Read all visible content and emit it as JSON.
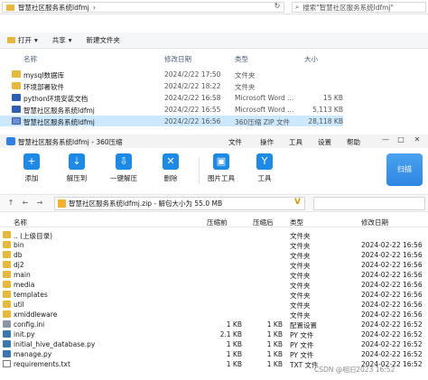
{
  "explorer": {
    "path": [
      "智慧社区服务系统ldfmj",
      "›"
    ],
    "search_placeholder": "搜索\"智慧社区服务系统ldfmj\"",
    "toolbar": {
      "open": "打开",
      "share": "共享",
      "new_folder": "新建文件夹"
    },
    "columns": {
      "name": "名称",
      "date": "修改日期",
      "type": "类型",
      "size": "大小"
    },
    "rows": [
      {
        "name": "mysql数据库",
        "date": "2024/2/22 17:50",
        "type": "文件夹",
        "size": "",
        "icon": "folder"
      },
      {
        "name": "环境部署软件",
        "date": "2024/2/22 18:22",
        "type": "文件夹",
        "size": "",
        "icon": "folder"
      },
      {
        "name": "python环境安装文档",
        "date": "2024/2/22 16:58",
        "type": "Microsoft Word ...",
        "size": "15 KB",
        "icon": "doc"
      },
      {
        "name": "智慧社区服务系统ldfmj",
        "date": "2024/2/22 16:55",
        "type": "Microsoft Word ...",
        "size": "5,113 KB",
        "icon": "doc"
      },
      {
        "name": "智慧社区服务系统ldfmj",
        "date": "2024/2/22 16:56",
        "type": "360压缩 ZIP 文件",
        "size": "28,118 KB",
        "icon": "zip"
      }
    ]
  },
  "zip": {
    "title": "智慧社区服务系统ldfmj - 360压缩",
    "menus": [
      "文件",
      "操作",
      "工具",
      "设置",
      "帮助"
    ],
    "buttons": [
      "添加",
      "解压到",
      "一键解压",
      "删除",
      "图片工具",
      "工具"
    ],
    "scan": "扫描",
    "path": "智慧社区服务系统ldfmj.zip - 解包大小为 55.0 MB",
    "columns": {
      "name": "名称",
      "packed": "压缩前",
      "ratio": "压缩后",
      "type": "类型",
      "modified": "修改日期"
    },
    "rows": [
      {
        "name": ".. (上级目录)",
        "packed": "",
        "ratio": "",
        "type": "文件夹",
        "modified": "",
        "icon": "folder"
      },
      {
        "name": "bin",
        "packed": "",
        "ratio": "",
        "type": "文件夹",
        "modified": "2024-02-22 16:56",
        "icon": "folder"
      },
      {
        "name": "db",
        "packed": "",
        "ratio": "",
        "type": "文件夹",
        "modified": "2024-02-22 16:56",
        "icon": "folder"
      },
      {
        "name": "dj2",
        "packed": "",
        "ratio": "",
        "type": "文件夹",
        "modified": "2024-02-22 16:56",
        "icon": "folder"
      },
      {
        "name": "main",
        "packed": "",
        "ratio": "",
        "type": "文件夹",
        "modified": "2024-02-22 16:56",
        "icon": "folder"
      },
      {
        "name": "media",
        "packed": "",
        "ratio": "",
        "type": "文件夹",
        "modified": "2024-02-22 16:56",
        "icon": "folder"
      },
      {
        "name": "templates",
        "packed": "",
        "ratio": "",
        "type": "文件夹",
        "modified": "2024-02-22 16:56",
        "icon": "folder"
      },
      {
        "name": "util",
        "packed": "",
        "ratio": "",
        "type": "文件夹",
        "modified": "2024-02-22 16:56",
        "icon": "folder"
      },
      {
        "name": "xmiddleware",
        "packed": "",
        "ratio": "",
        "type": "文件夹",
        "modified": "2024-02-22 16:56",
        "icon": "folder"
      },
      {
        "name": "config.ini",
        "packed": "1 KB",
        "ratio": "1 KB",
        "type": "配置设置",
        "modified": "2024-02-22 16:52",
        "icon": "cfg"
      },
      {
        "name": "init.py",
        "packed": "2.1 KB",
        "ratio": "1 KB",
        "type": "PY 文件",
        "modified": "2024-02-22 16:52",
        "icon": "py"
      },
      {
        "name": "initial_hive_database.py",
        "packed": "1 KB",
        "ratio": "1 KB",
        "type": "PY 文件",
        "modified": "2024-02-22 16:52",
        "icon": "py"
      },
      {
        "name": "manage.py",
        "packed": "1 KB",
        "ratio": "1 KB",
        "type": "PY 文件",
        "modified": "2024-02-22 16:52",
        "icon": "py"
      },
      {
        "name": "requirements.txt",
        "packed": "1 KB",
        "ratio": "1 KB",
        "type": "TXT 文件",
        "modified": "2024-02-22 16:52",
        "icon": "txt"
      }
    ],
    "watermark": "CSDN @相旧2023 16:52"
  }
}
